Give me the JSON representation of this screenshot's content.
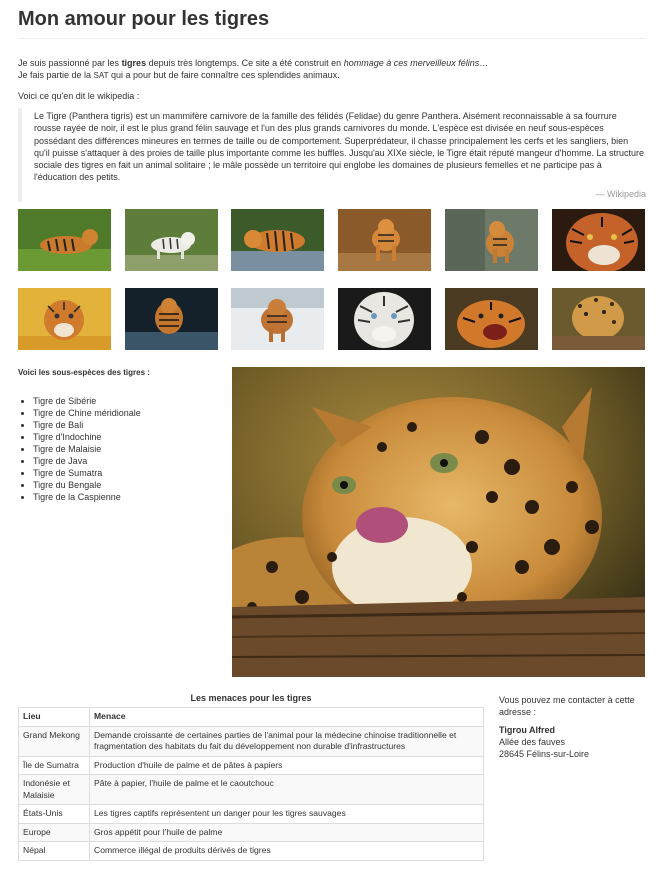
{
  "title": "Mon amour pour les tigres",
  "intro": {
    "line1_a": "Je suis passionné par les ",
    "line1_bold": "tigres",
    "line1_b": " depuis très longtemps. Ce site a été construit en ",
    "line1_em": "hommage à ces merveilleux félins",
    "line1_c": "…",
    "line2_a": "Je fais partie de la ",
    "line2_abbr": "SAT",
    "line2_b": " qui a pour but de faire connaître ces splendides animaux."
  },
  "wiki_lead": "Voici ce qu'en dit le wikipedia :",
  "quote": {
    "text": "Le Tigre (Panthera tigris) est un mammifère carnivore de la famille des félidés (Felidae) du genre Panthera. Aisément reconnaissable à sa fourrure rousse rayée de noir, il est le plus grand félin sauvage et l'un des plus grands carnivores du monde. L'espèce est divisée en neuf sous-espèces possédant des différences mineures en termes de taille ou de comportement. Superprédateur, il chasse principalement les cerfs et les sangliers, bien qu'il puisse s'attaquer à des proies de taille plus importante comme les buffles. Jusqu'au XIXe siècle, le Tigre était réputé mangeur d'homme. La structure sociale des tigres en fait un animal solitaire ; le mâle possède un territoire qui englobe les domaines de plusieurs femelles et ne participe pas à l'éducation des petits.",
    "source": "— Wikipedia"
  },
  "subspecies": {
    "heading": "Voici les sous-espèces des tigres :",
    "items": [
      "Tigre de Sibérie",
      "Tigre de Chine méridionale",
      "Tigre de Bali",
      "Tigre d'Indochine",
      "Tigre de Malaisie",
      "Tigre de Java",
      "Tigre de Sumatra",
      "Tigre du Bengale",
      "Tigre de la Caspienne"
    ]
  },
  "threats": {
    "caption": "Les menaces pour les tigres",
    "headers": [
      "Lieu",
      "Menace"
    ],
    "rows": [
      [
        "Grand Mekong",
        "Demande croissante de certaines parties de l'animal pour la médecine chinoise traditionnelle et fragmentation des habitats du fait du développement non durable d'infrastructures"
      ],
      [
        "Île de Sumatra",
        "Production d'huile de palme et de pâtes à papiers"
      ],
      [
        "Indonésie et Malaisie",
        "Pâte à papier, l'huile de palme et le caoutchouc"
      ],
      [
        "États-Unis",
        "Les tigres captifs représentent un danger pour les tigres sauvages"
      ],
      [
        "Europe",
        "Gros appétit pour l'huile de palme"
      ],
      [
        "Népal",
        "Commerce illégal de produits dérivés de tigres"
      ]
    ]
  },
  "contact": {
    "lead": "Vous pouvez me contacter à cette adresse :",
    "name": "Tigrou Alfred",
    "street": "Allée des fauves",
    "city": "28645 Félins-sur-Loire"
  },
  "colors": {
    "tiger_orange": "#c8741f",
    "grass": "#5e8a2e",
    "snow": "#e8ecef"
  }
}
